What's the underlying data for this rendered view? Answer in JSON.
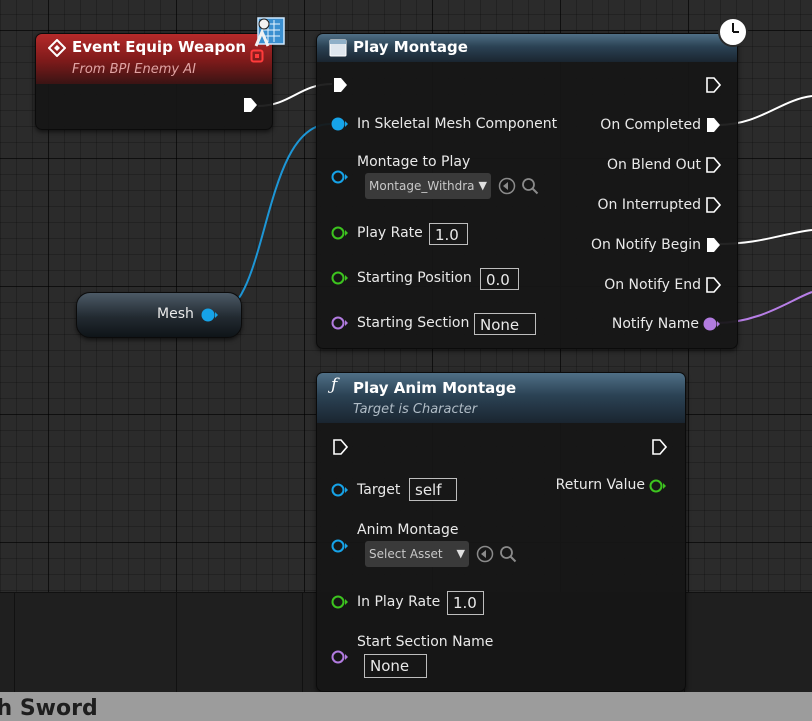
{
  "colors": {
    "exec": "#ffffff",
    "object_pin": "#16a3e8",
    "float_pin": "#3dc41f",
    "name_pin": "#b27be0",
    "wire_exec": "#ffffff",
    "wire_object": "#1d96d6",
    "wire_name": "#b77ee6"
  },
  "event_node": {
    "title": "Event Equip Weapon",
    "subtitle": "From BPI Enemy AI",
    "icons": [
      "diamond-event-icon",
      "stop-delegate-icon",
      "interface-badge-icon"
    ]
  },
  "mesh_node": {
    "label": "Mesh"
  },
  "play_montage": {
    "title": "Play Montage",
    "icons": [
      "clock-icon",
      "node-icon"
    ],
    "inputs": {
      "skeletal_mesh": "In Skeletal Mesh Component",
      "montage_label": "Montage to Play",
      "montage_value": "Montage_Withdra",
      "play_rate_label": "Play Rate",
      "play_rate_value": "1.0",
      "start_pos_label": "Starting Position",
      "start_pos_value": "0.0",
      "start_section_label": "Starting Section",
      "start_section_value": "None"
    },
    "outputs": {
      "on_completed": "On Completed",
      "on_blend_out": "On Blend Out",
      "on_interrupted": "On Interrupted",
      "on_notify_begin": "On Notify Begin",
      "on_notify_end": "On Notify End",
      "notify_name": "Notify Name"
    }
  },
  "play_anim_montage": {
    "title": "Play Anim Montage",
    "subtitle": "Target is Character",
    "icons": [
      "function-icon"
    ],
    "inputs": {
      "target_label": "Target",
      "target_value": "self",
      "anim_montage_label": "Anim Montage",
      "anim_montage_value": "Select Asset",
      "in_play_rate_label": "In Play Rate",
      "in_play_rate_value": "1.0",
      "start_section_label": "Start Section Name",
      "start_section_value": "None"
    },
    "outputs": {
      "return_value": "Return Value"
    }
  },
  "status_bar": {
    "text": "th Sword"
  }
}
